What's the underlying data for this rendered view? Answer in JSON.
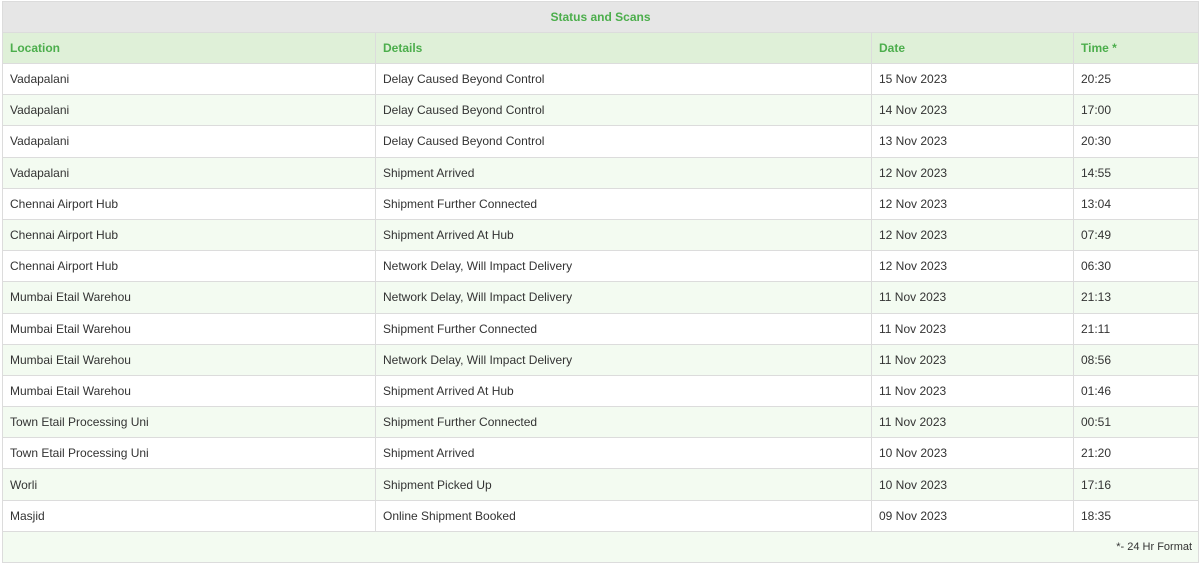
{
  "table": {
    "title": "Status and Scans",
    "headers": {
      "location": "Location",
      "details": "Details",
      "date": "Date",
      "time": "Time *"
    },
    "rows": [
      {
        "location": "Vadapalani",
        "details": "Delay Caused Beyond Control",
        "date": "15 Nov 2023",
        "time": "20:25"
      },
      {
        "location": "Vadapalani",
        "details": "Delay Caused Beyond Control",
        "date": "14 Nov 2023",
        "time": "17:00"
      },
      {
        "location": "Vadapalani",
        "details": "Delay Caused Beyond Control",
        "date": "13 Nov 2023",
        "time": "20:30"
      },
      {
        "location": "Vadapalani",
        "details": "Shipment Arrived",
        "date": "12 Nov 2023",
        "time": "14:55"
      },
      {
        "location": "Chennai Airport Hub",
        "details": "Shipment Further Connected",
        "date": "12 Nov 2023",
        "time": "13:04"
      },
      {
        "location": "Chennai Airport Hub",
        "details": "Shipment Arrived At Hub",
        "date": "12 Nov 2023",
        "time": "07:49"
      },
      {
        "location": "Chennai Airport Hub",
        "details": "Network Delay, Will Impact Delivery",
        "date": "12 Nov 2023",
        "time": "06:30"
      },
      {
        "location": "Mumbai Etail Warehou",
        "details": "Network Delay, Will Impact Delivery",
        "date": "11 Nov 2023",
        "time": "21:13"
      },
      {
        "location": "Mumbai Etail Warehou",
        "details": "Shipment Further Connected",
        "date": "11 Nov 2023",
        "time": "21:11"
      },
      {
        "location": "Mumbai Etail Warehou",
        "details": "Network Delay, Will Impact Delivery",
        "date": "11 Nov 2023",
        "time": "08:56"
      },
      {
        "location": "Mumbai Etail Warehou",
        "details": "Shipment Arrived At Hub",
        "date": "11 Nov 2023",
        "time": "01:46"
      },
      {
        "location": "Town Etail Processing Uni",
        "details": "Shipment Further Connected",
        "date": "11 Nov 2023",
        "time": "00:51"
      },
      {
        "location": "Town Etail Processing Uni",
        "details": "Shipment Arrived",
        "date": "10 Nov 2023",
        "time": "21:20"
      },
      {
        "location": "Worli",
        "details": "Shipment Picked Up",
        "date": "10 Nov 2023",
        "time": "17:16"
      },
      {
        "location": "Masjid",
        "details": "Online Shipment Booked",
        "date": "09 Nov 2023",
        "time": "18:35"
      }
    ],
    "footnote": "*- 24 Hr Format"
  },
  "colors": {
    "accent": "#4cae4c",
    "header_bg": "#dff0d8",
    "title_bg": "#e6e6e6",
    "alt_row_bg": "#f3fbf1"
  }
}
